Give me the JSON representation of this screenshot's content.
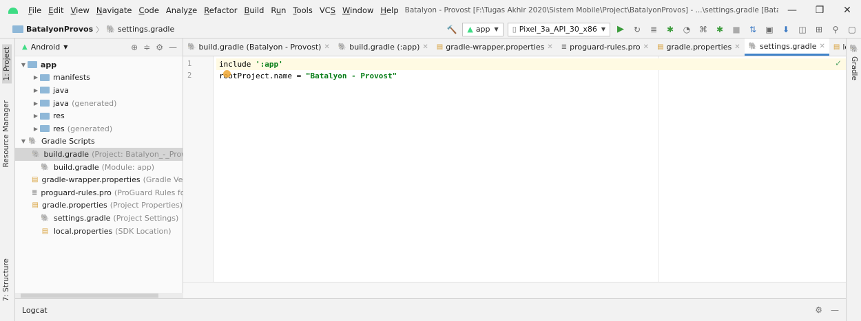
{
  "menu": {
    "items": [
      {
        "label": "File",
        "u": "F",
        "rest": "ile"
      },
      {
        "label": "Edit",
        "u": "E",
        "rest": "dit"
      },
      {
        "label": "View",
        "u": "V",
        "rest": "iew"
      },
      {
        "label": "Navigate",
        "u": "N",
        "rest": "avigate"
      },
      {
        "label": "Code",
        "u": "C",
        "rest": "ode"
      },
      {
        "label": "Analyze",
        "pre": "Analy",
        "u": "z",
        "rest": "e"
      },
      {
        "label": "Refactor",
        "u": "R",
        "rest": "efactor"
      },
      {
        "label": "Build",
        "u": "B",
        "rest": "uild"
      },
      {
        "label": "Run",
        "pre": "R",
        "u": "u",
        "rest": "n"
      },
      {
        "label": "Tools",
        "u": "T",
        "rest": "ools"
      },
      {
        "label": "VCS",
        "pre": "VC",
        "u": "S",
        "rest": ""
      },
      {
        "label": "Window",
        "u": "W",
        "rest": "indow"
      },
      {
        "label": "Help",
        "u": "H",
        "rest": "elp"
      }
    ],
    "window_title": "Batalyon - Provost [F:\\Tugas Akhir 2020\\Sistem Mobile\\Project\\BatalyonProvos] - ...\\settings.gradle [Batalyon_-_Provost]"
  },
  "navbar": {
    "project": "BatalyonProvos",
    "file": "settings.gradle",
    "run_config": "app",
    "device": "Pixel_3a_API_30_x86"
  },
  "project_panel": {
    "view_mode": "Android",
    "tree": [
      {
        "label": "app",
        "hint": "",
        "level": 0,
        "expanded": true,
        "icon": "folder-icon",
        "bold": true
      },
      {
        "label": "manifests",
        "hint": "",
        "level": 1,
        "expanded": false,
        "icon": "folder-icon"
      },
      {
        "label": "java",
        "hint": "",
        "level": 1,
        "expanded": false,
        "icon": "folder-icon"
      },
      {
        "label": "java",
        "hint": "(generated)",
        "level": 1,
        "expanded": false,
        "icon": "folder-icon"
      },
      {
        "label": "res",
        "hint": "",
        "level": 1,
        "expanded": false,
        "icon": "res-folder-icon"
      },
      {
        "label": "res",
        "hint": "(generated)",
        "level": 1,
        "expanded": false,
        "icon": "res-folder-icon"
      },
      {
        "label": "Gradle Scripts",
        "hint": "",
        "level": 0,
        "expanded": true,
        "icon": "gradle-icon"
      },
      {
        "label": "build.gradle",
        "hint": "(Project: Batalyon_-_Provo",
        "level": 1,
        "leaf": true,
        "icon": "gradle-icon",
        "selected": true
      },
      {
        "label": "build.gradle",
        "hint": "(Module: app)",
        "level": 1,
        "leaf": true,
        "icon": "gradle-icon"
      },
      {
        "label": "gradle-wrapper.properties",
        "hint": "(Gradle Vers",
        "level": 1,
        "leaf": true,
        "icon": "properties-icon"
      },
      {
        "label": "proguard-rules.pro",
        "hint": "(ProGuard Rules fo",
        "level": 1,
        "leaf": true,
        "icon": "text-file-icon"
      },
      {
        "label": "gradle.properties",
        "hint": "(Project Properties)",
        "level": 1,
        "leaf": true,
        "icon": "properties-icon"
      },
      {
        "label": "settings.gradle",
        "hint": "(Project Settings)",
        "level": 1,
        "leaf": true,
        "icon": "gradle-icon"
      },
      {
        "label": "local.properties",
        "hint": "(SDK Location)",
        "level": 1,
        "leaf": true,
        "icon": "properties-icon"
      }
    ]
  },
  "left_tabs": {
    "project": "1: Project",
    "resource_manager": "Resource Manager",
    "structure": "7: Structure"
  },
  "right_tabs": {
    "gradle": "Gradle"
  },
  "editor_tabs": [
    {
      "label": "build.gradle (Batalyon - Provost)",
      "icon": "gradle-icon",
      "active": false
    },
    {
      "label": "build.gradle (:app)",
      "icon": "gradle-icon",
      "active": false
    },
    {
      "label": "gradle-wrapper.properties",
      "icon": "properties-icon",
      "active": false
    },
    {
      "label": "proguard-rules.pro",
      "icon": "text-file-icon",
      "active": false
    },
    {
      "label": "gradle.properties",
      "icon": "properties-icon",
      "active": false
    },
    {
      "label": "settings.gradle",
      "icon": "gradle-icon",
      "active": true
    },
    {
      "label": "lo",
      "icon": "properties-icon",
      "active": false
    }
  ],
  "editor_tabs_overflow": "≡₃",
  "editor": {
    "lines": [
      {
        "n": "1",
        "parts": [
          {
            "t": "include ",
            "c": "kw"
          },
          {
            "t": "':app'",
            "c": "str"
          }
        ]
      },
      {
        "n": "2",
        "parts": [
          {
            "t": "rootProject.name = ",
            "c": "kw"
          },
          {
            "t": "\"Batalyon - Provost\"",
            "c": "str"
          }
        ]
      }
    ]
  },
  "bottom_panel": {
    "title": "Logcat"
  },
  "colors": {
    "accent": "#4083c9",
    "android_green": "#3ddc84",
    "string": "#067d17",
    "current_line": "#fffae3"
  }
}
